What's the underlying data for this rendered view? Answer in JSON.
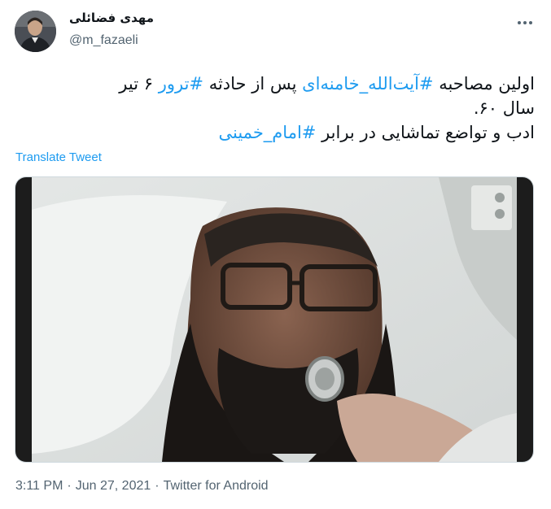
{
  "author": {
    "display_name": "مهدی فضائلی",
    "handle": "@m_fazaeli"
  },
  "tweet": {
    "line1": {
      "pre": "اولین مصاحبه ",
      "hashtag1": "#آیت‌الله_خامنه‌ای",
      "mid": " پس از حادثه ",
      "hashtag2": "#ترور",
      "post": " ۶ تیر"
    },
    "line2": "سال ۶۰.",
    "line3": {
      "pre": "ادب و تواضع تماشایی در برابر ",
      "hashtag": "#امام_خمینی"
    }
  },
  "translate_label": "Translate Tweet",
  "meta": {
    "time": "3:11 PM",
    "separator": "·",
    "date": "Jun 27, 2021",
    "source": "Twitter for Android"
  },
  "colors": {
    "link": "#1d9bf0",
    "text": "#0f1419",
    "secondary": "#536471"
  },
  "icons": {
    "more": "more-horizontal-icon"
  }
}
